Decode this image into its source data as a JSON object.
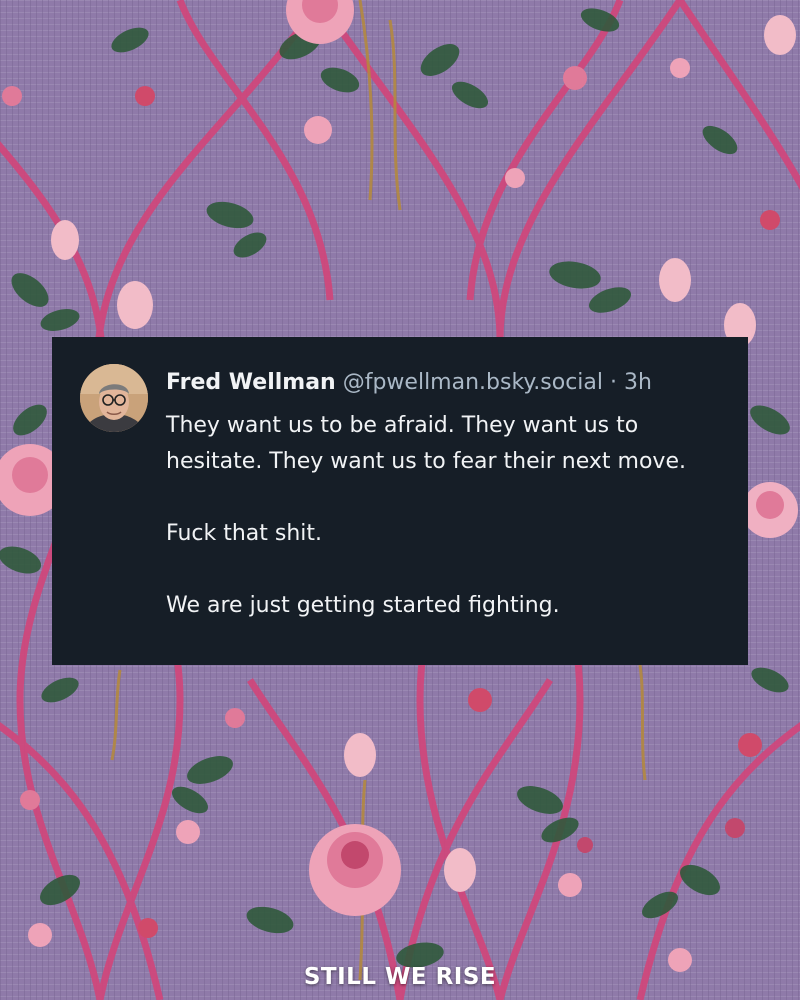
{
  "post": {
    "author_name": "Fred Wellman",
    "author_handle": "@fpwellman.bsky.social",
    "separator": "·",
    "timestamp": "3h",
    "text_lines": {
      "p1": "They want us to be afraid. They want us to hesitate. They want us to fear their next move.",
      "p2": "Fuck that shit.",
      "p3": "We are just getting started fighting."
    }
  },
  "footer": {
    "label": "STILL WE RISE"
  },
  "colors": {
    "card_background": "#161e27",
    "wallpaper_base": "#8e7aa8",
    "wallpaper_stripe": "#d2457a",
    "rose_pink": "#eea3b8",
    "leaf_green": "#2f5a3c"
  },
  "icons": {
    "avatar": "author-avatar-photo"
  }
}
